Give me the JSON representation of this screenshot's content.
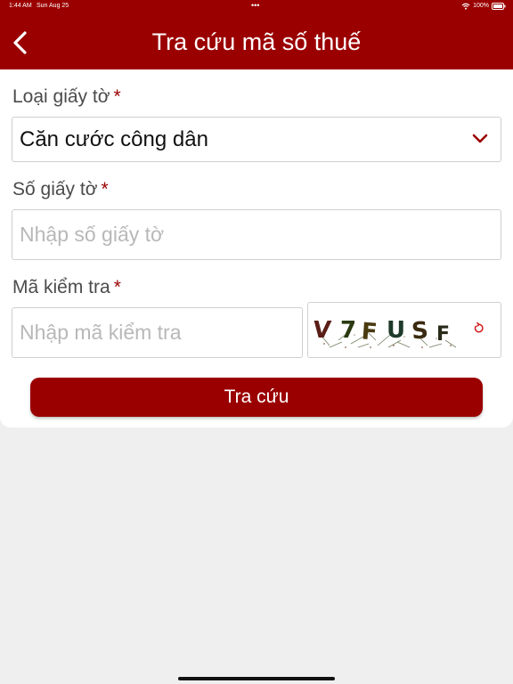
{
  "status_bar": {
    "time": "1:44 AM",
    "date": "Sun Aug 25",
    "dots": "•••",
    "battery": "100%",
    "wifi_icon": "wifi-icon",
    "battery_icon": "battery-icon"
  },
  "header": {
    "title": "Tra cứu mã số thuế",
    "back_icon": "chevron-left-icon",
    "background": "#9b0000"
  },
  "form": {
    "doc_type": {
      "label": "Loại giấy tờ",
      "required_mark": "*",
      "value": "Căn cước công dân",
      "icon": "chevron-down-icon"
    },
    "doc_number": {
      "label": "Số giấy tờ",
      "required_mark": "*",
      "placeholder": "Nhập số giấy tờ",
      "value": ""
    },
    "captcha": {
      "label": "Mã kiểm tra",
      "required_mark": "*",
      "placeholder": "Nhập mã kiểm tra",
      "value": "",
      "image_text": "V7FUSF",
      "refresh_icon": "refresh-icon"
    },
    "submit_label": "Tra cứu"
  },
  "colors": {
    "accent": "#9b0000",
    "page_bg": "#efefef"
  }
}
